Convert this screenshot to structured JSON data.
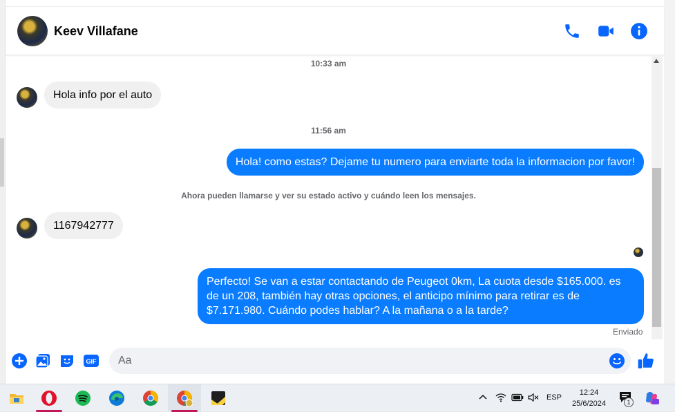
{
  "header": {
    "contact_name": "Keev Villafane",
    "icons": [
      "phone-icon",
      "video-call-icon",
      "info-icon"
    ],
    "accent_color": "#0866ff"
  },
  "messages": {
    "time1": "10:33 am",
    "msg1": "Hola info por el auto",
    "time2": "11:56 am",
    "msg2": "Hola! como estas? Dejame tu numero para enviarte toda la informacion por favor!",
    "notice": "Ahora pueden llamarse y ver su estado activo y cuándo leen los mensajes.",
    "msg3": "1167942777",
    "msg4": "Perfecto!  Se van a estar contactando de Peugeot 0km, La cuota desde $165.000. es de un 208, también hay otras opciones, el anticipo mínimo para retirar es de $7.171.980. Cuándo podes hablar? A la mañana o a la tarde?",
    "status": "Enviado",
    "outgoing_color": "#0a7cff",
    "incoming_color": "#f0f0f0"
  },
  "composer": {
    "placeholder": "Aa",
    "icons": [
      "plus-icon",
      "photo-icon",
      "sticker-icon",
      "gif-icon",
      "emoji-icon",
      "thumbs-up-icon"
    ],
    "gif_label": "GIF"
  },
  "taskbar": {
    "apps": [
      "file-explorer",
      "opera",
      "spotify",
      "edge",
      "chrome",
      "chrome-profile",
      "sticky-notes"
    ],
    "language": "ESP",
    "time": "12:24",
    "date": "25/6/2024",
    "notification_count": "1"
  }
}
